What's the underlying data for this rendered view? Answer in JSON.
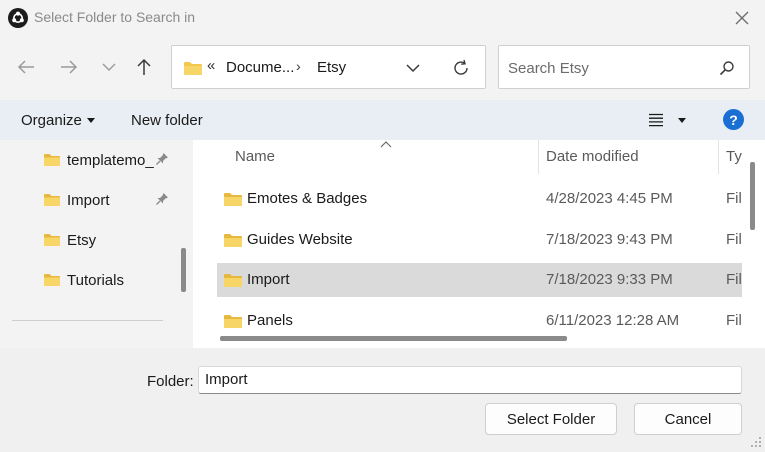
{
  "window": {
    "title": "Select Folder to Search in"
  },
  "address": {
    "overflow_glyph": "«",
    "crumbs": [
      "Docume...",
      "Etsy"
    ],
    "separator": "›"
  },
  "search": {
    "placeholder": "Search Etsy"
  },
  "commandbar": {
    "organize_label": "Organize",
    "new_folder_label": "New folder",
    "help_glyph": "?"
  },
  "sidebar": {
    "items": [
      {
        "label": "templatemo_",
        "pinned": true
      },
      {
        "label": "Import",
        "pinned": true
      },
      {
        "label": "Etsy",
        "pinned": false
      },
      {
        "label": "Tutorials",
        "pinned": false
      }
    ]
  },
  "filelist": {
    "columns": [
      "Name",
      "Date modified",
      "Typ"
    ],
    "rows": [
      {
        "name": "Emotes & Badges",
        "date": "4/28/2023 4:45 PM",
        "type": "File folder",
        "selected": false
      },
      {
        "name": "Guides Website",
        "date": "7/18/2023 9:43 PM",
        "type": "File folder",
        "selected": false
      },
      {
        "name": "Import",
        "date": "7/18/2023 9:33 PM",
        "type": "File folder",
        "selected": true
      },
      {
        "name": "Panels",
        "date": "6/11/2023 12:28 AM",
        "type": "File folder",
        "selected": false
      }
    ]
  },
  "footer": {
    "folder_label": "Folder:",
    "folder_value": "Import",
    "select_button": "Select Folder",
    "cancel_button": "Cancel"
  },
  "colors": {
    "folder": "#f2c94c",
    "help": "#1a6fd4",
    "selected_row": "#dadada",
    "cmdbar": "#e9eef4"
  },
  "icons": [
    "app-icon",
    "close-icon",
    "back-arrow-icon",
    "forward-arrow-icon",
    "recent-dropdown-icon",
    "up-arrow-icon",
    "folder-icon",
    "chevron-down-icon",
    "refresh-icon",
    "search-icon",
    "view-list-icon",
    "help-icon",
    "pin-icon",
    "resize-grip-icon"
  ]
}
